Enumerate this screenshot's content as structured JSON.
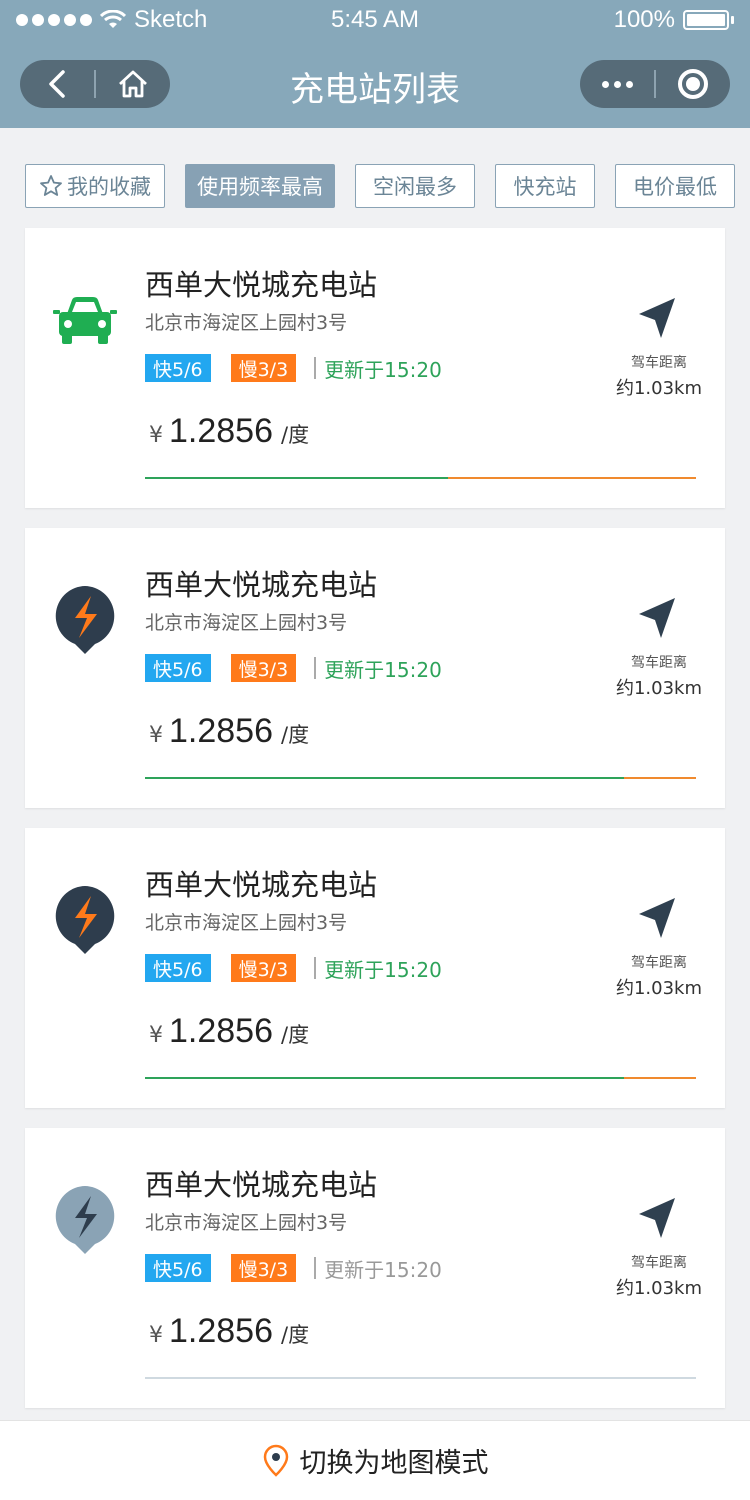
{
  "status_bar": {
    "carrier": "Sketch",
    "time": "5:45 AM",
    "battery": "100%"
  },
  "header": {
    "title": "充电站列表"
  },
  "filters": [
    {
      "label": "我的收藏",
      "active": false,
      "icon": "star-icon"
    },
    {
      "label": "使用频率最高",
      "active": true
    },
    {
      "label": "空闲最多",
      "active": false
    },
    {
      "label": "快充站",
      "active": false
    },
    {
      "label": "电价最低",
      "active": false
    }
  ],
  "stations": [
    {
      "icon": "car-icon",
      "name": "西单大悦城充电站",
      "address": "北京市海淀区上园村3号",
      "fast": "快5/6",
      "slow": "慢3/3",
      "updated": "更新于15:20",
      "currency": "¥",
      "price": "1.2856",
      "unit": "/度",
      "distance_label": "驾车距离",
      "distance": "约1.03km",
      "ratio": 0.55,
      "state": "green"
    },
    {
      "icon": "lightning-pin-icon",
      "name": "西单大悦城充电站",
      "address": "北京市海淀区上园村3号",
      "fast": "快5/6",
      "slow": "慢3/3",
      "updated": "更新于15:20",
      "currency": "¥",
      "price": "1.2856",
      "unit": "/度",
      "distance_label": "驾车距离",
      "distance": "约1.03km",
      "ratio": 0.87,
      "state": "orange"
    },
    {
      "icon": "lightning-pin-icon",
      "name": "西单大悦城充电站",
      "address": "北京市海淀区上园村3号",
      "fast": "快5/6",
      "slow": "慢3/3",
      "updated": "更新于15:20",
      "currency": "¥",
      "price": "1.2856",
      "unit": "/度",
      "distance_label": "驾车距离",
      "distance": "约1.03km",
      "ratio": 0.87,
      "state": "orange"
    },
    {
      "icon": "lightning-pin-icon",
      "name": "西单大悦城充电站",
      "address": "北京市海淀区上园村3号",
      "fast": "快5/6",
      "slow": "慢3/3",
      "updated": "更新于15:20",
      "currency": "¥",
      "price": "1.2856",
      "unit": "/度",
      "distance_label": "驾车距离",
      "distance": "约1.03km",
      "ratio": 0,
      "state": "gray"
    }
  ],
  "bottom": {
    "label": "切换为地图模式",
    "icon": "map-pin-icon"
  },
  "colors": {
    "header": "#87a8ba",
    "fast": "#22a7f0",
    "slow": "#ff7a1a",
    "green": "#2ea35a",
    "orange": "#f08a2e"
  }
}
